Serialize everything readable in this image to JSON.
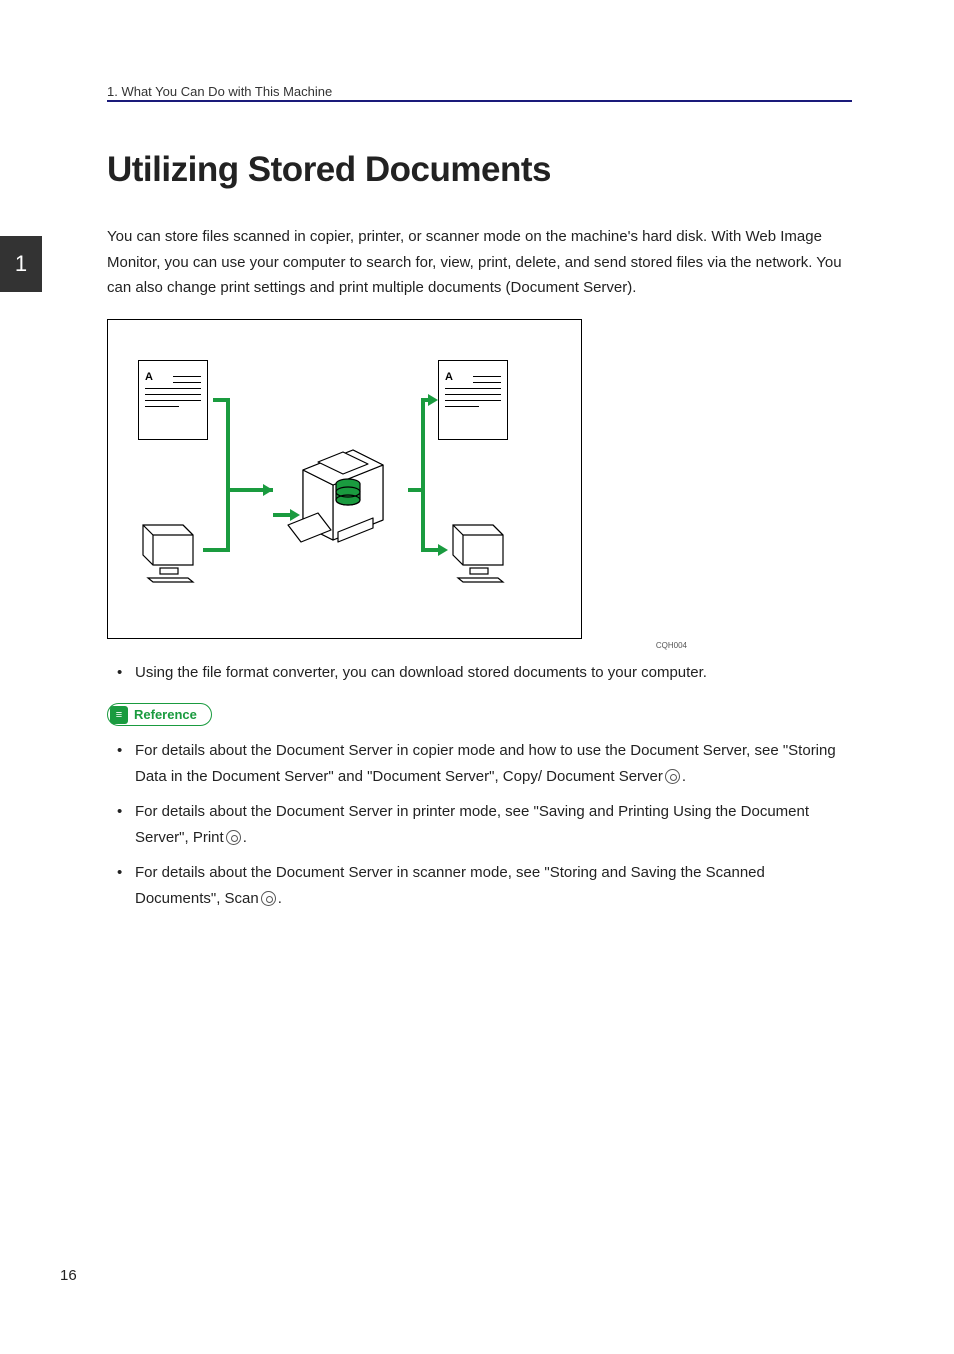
{
  "header": {
    "breadcrumb": "1. What You Can Do with This Machine"
  },
  "chapter_tab": "1",
  "heading": "Utilizing Stored Documents",
  "intro": "You can store files scanned in copier, printer, or scanner mode on the machine's hard disk. With Web Image Monitor, you can use your computer to search for, view, print, delete, and send stored files via the network. You can also change print settings and print multiple documents (Document Server).",
  "figure": {
    "label_left": "A",
    "label_right": "A",
    "caption_id": "CQH004"
  },
  "bullet_1": "Using the file format converter, you can download stored documents to your computer.",
  "reference_label": "Reference",
  "ref_items": {
    "item1_a": "For details about the Document Server in copier mode and how to use the Document Server, see \"Storing Data in the Document Server\" and \"Document Server\", Copy/ Document Server",
    "item1_b": ".",
    "item2_a": "For details about the Document Server in printer mode, see \"Saving and Printing Using the Document Server\", Print",
    "item2_b": ".",
    "item3_a": "For details about the Document Server in scanner mode, see \"Storing and Saving the Scanned Documents\", Scan",
    "item3_b": "."
  },
  "page_number": "16"
}
